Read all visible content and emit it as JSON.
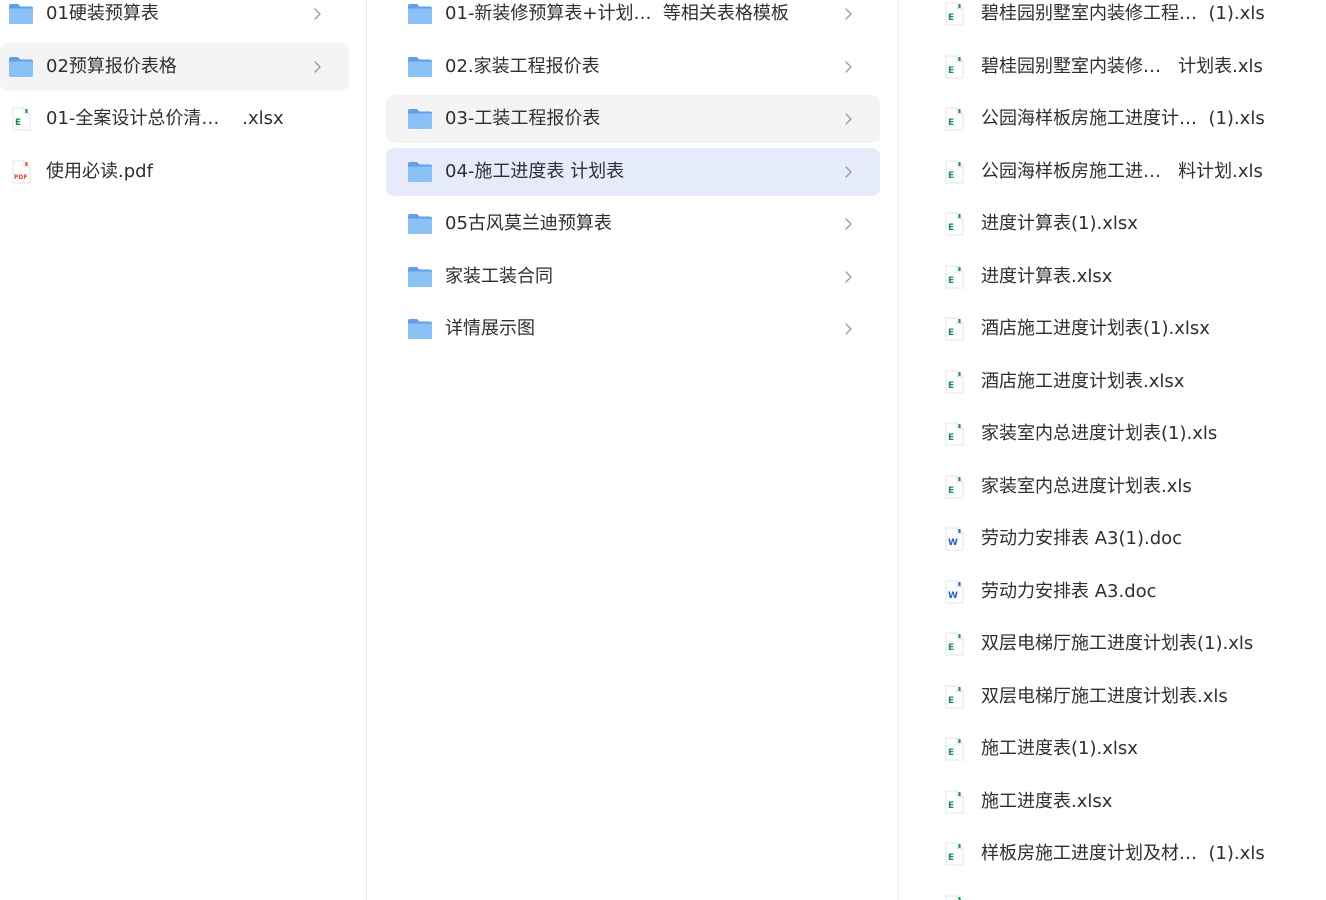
{
  "columns": [
    {
      "items": [
        {
          "label": "01硬装预算表",
          "type": "folder",
          "state": "normal"
        },
        {
          "label": "02预算报价表格",
          "type": "folder",
          "state": "hover"
        },
        {
          "label": "01-全案设计总价清…    .xlsx",
          "type": "excel",
          "state": "normal"
        },
        {
          "label": "使用必读.pdf",
          "type": "pdf",
          "state": "normal"
        }
      ]
    },
    {
      "items": [
        {
          "label": "01-新装修预算表+计划…  等相关表格模板",
          "type": "folder",
          "state": "normal"
        },
        {
          "label": "02.家装工程报价表",
          "type": "folder",
          "state": "normal"
        },
        {
          "label": "03-工装工程报价表",
          "type": "folder",
          "state": "hover"
        },
        {
          "label": "04-施工进度表 计划表",
          "type": "folder",
          "state": "selected"
        },
        {
          "label": "05古风莫兰迪预算表",
          "type": "folder",
          "state": "normal"
        },
        {
          "label": "家装工装合同",
          "type": "folder",
          "state": "normal"
        },
        {
          "label": "详情展示图",
          "type": "folder",
          "state": "normal"
        }
      ]
    },
    {
      "items": [
        {
          "label": "碧桂园别墅室内装修工程…  (1).xls",
          "type": "excel"
        },
        {
          "label": "碧桂园别墅室内装修…   计划表.xls",
          "type": "excel"
        },
        {
          "label": "公园海样板房施工进度计…  (1).xls",
          "type": "excel"
        },
        {
          "label": "公园海样板房施工进…   料计划.xls",
          "type": "excel"
        },
        {
          "label": "进度计算表(1).xlsx",
          "type": "excel"
        },
        {
          "label": "进度计算表.xlsx",
          "type": "excel"
        },
        {
          "label": "酒店施工进度计划表(1).xlsx",
          "type": "excel"
        },
        {
          "label": "酒店施工进度计划表.xlsx",
          "type": "excel"
        },
        {
          "label": "家装室内总进度计划表(1).xls",
          "type": "excel"
        },
        {
          "label": "家装室内总进度计划表.xls",
          "type": "excel"
        },
        {
          "label": "劳动力安排表 A3(1).doc",
          "type": "word"
        },
        {
          "label": "劳动力安排表 A3.doc",
          "type": "word"
        },
        {
          "label": "双层电梯厅施工进度计划表(1).xls",
          "type": "excel"
        },
        {
          "label": "双层电梯厅施工进度计划表.xls",
          "type": "excel"
        },
        {
          "label": "施工进度表(1).xlsx",
          "type": "excel"
        },
        {
          "label": "施工进度表.xlsx",
          "type": "excel"
        },
        {
          "label": "样板房施工进度计划及材…  (1).xls",
          "type": "excel"
        },
        {
          "label": "",
          "type": "excel"
        }
      ]
    }
  ],
  "colors": {
    "folder_back": "#5f9fec",
    "folder_front": "#8cc1f5",
    "excel": "#1d8f4e",
    "word": "#2b5fbf",
    "pdf": "#e04a3f",
    "text": "#2d2f33",
    "chevron": "#9a9ca1",
    "hover_bg": "#f4f4f5",
    "selected_bg": "#e6ebfb"
  }
}
